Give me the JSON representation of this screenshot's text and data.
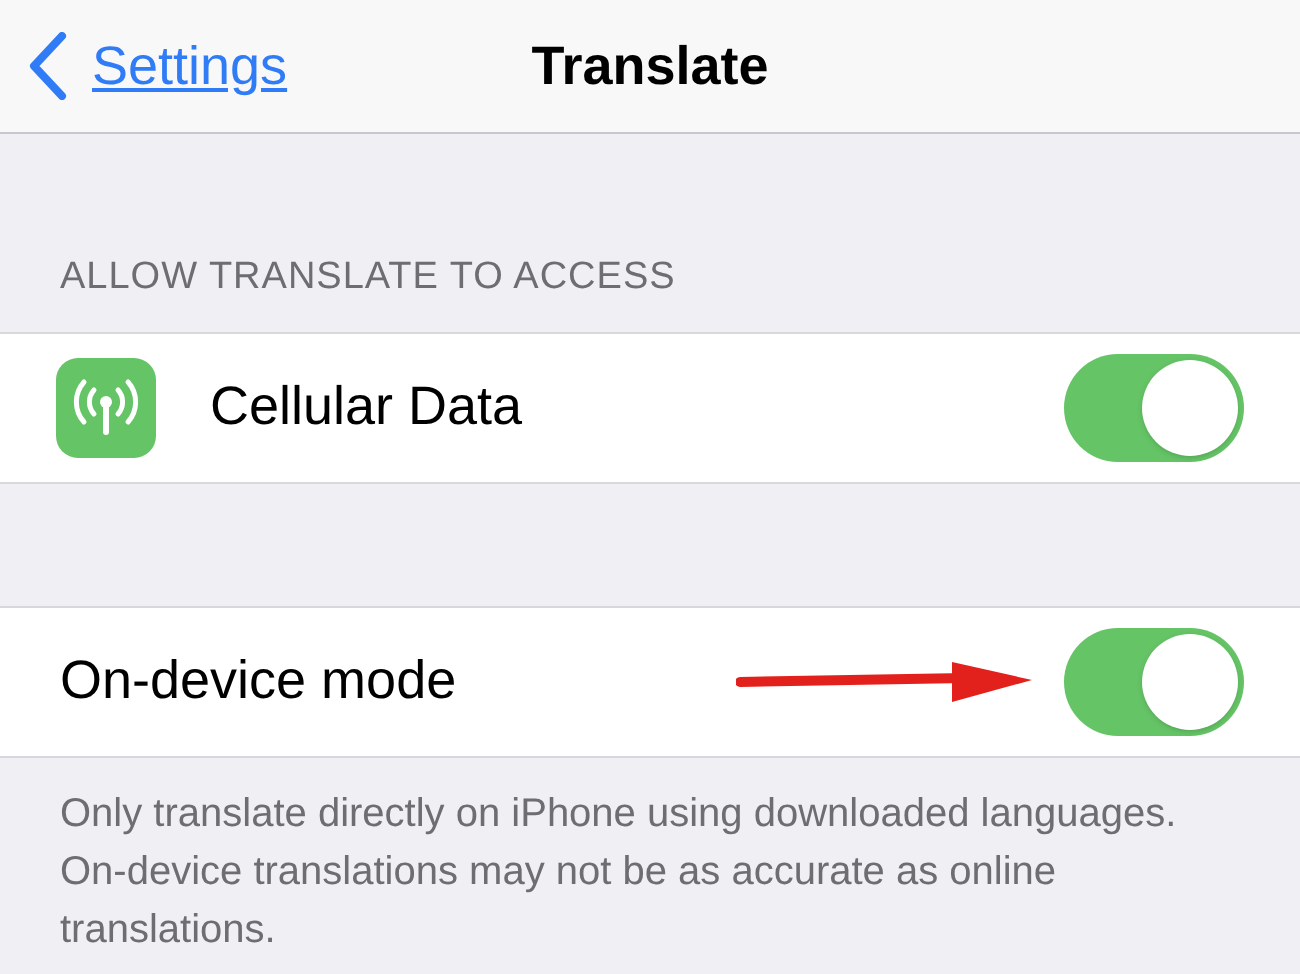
{
  "nav": {
    "back_label": "Settings",
    "title": "Translate"
  },
  "sections": [
    {
      "header": "ALLOW TRANSLATE TO ACCESS",
      "rows": [
        {
          "kind": "icon",
          "label": "Cellular Data",
          "on": true
        }
      ]
    },
    {
      "rows": [
        {
          "kind": "plain",
          "label": "On-device mode",
          "on": true,
          "annotated": true
        }
      ],
      "footer": "Only translate directly on iPhone using downloaded languages. On-device translations may not be as accurate as online translations."
    }
  ]
}
